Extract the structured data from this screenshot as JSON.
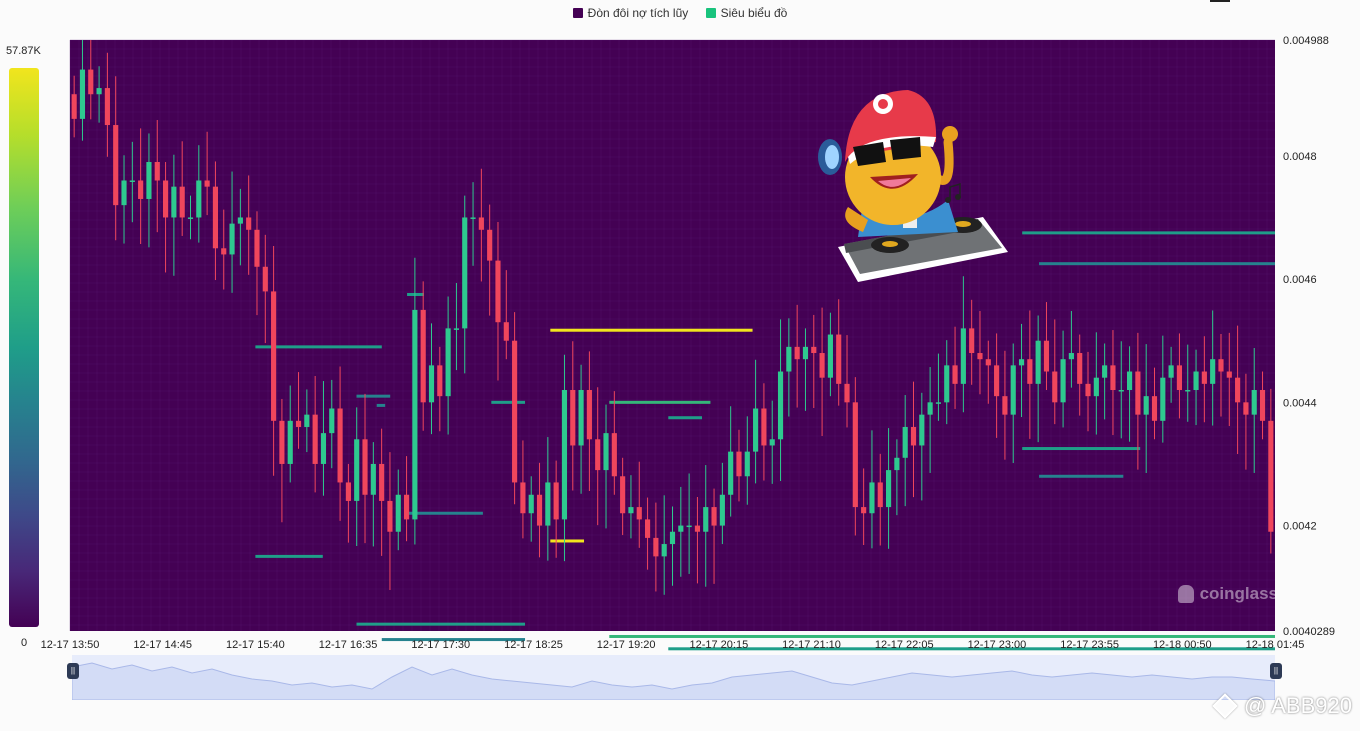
{
  "legend": {
    "items": [
      {
        "label": "Đòn đôi nợ tích lũy",
        "color": "#440154"
      },
      {
        "label": "Siêu biểu đồ",
        "color": "#19c37d"
      }
    ]
  },
  "colorbar": {
    "max_label": "57.87K",
    "min_label": "0"
  },
  "watermark": {
    "text": "coinglass"
  },
  "brand": {
    "text": "@ ABB920"
  },
  "chart_data": {
    "type": "candlestick",
    "background": "#440154",
    "up_color": "#2ec98f",
    "down_color": "#f0465c",
    "ylim": [
      0.0040289,
      0.004988
    ],
    "y_ticks": [
      "0.004988",
      "0.0048",
      "0.0046",
      "0.0044",
      "0.0042",
      "0.0040289"
    ],
    "x_ticks": [
      "12-17 13:50",
      "12-17 14:45",
      "12-17 15:40",
      "12-17 16:35",
      "12-17 17:30",
      "12-17 18:25",
      "12-17 19:20",
      "12-17 20:15",
      "12-17 21:10",
      "12-17 22:05",
      "12-17 23:00",
      "12-17 23:55",
      "12-18 00:50",
      "12-18 01:45"
    ],
    "candles_close": [
      0.00486,
      0.00494,
      0.0049,
      0.00491,
      0.00485,
      0.00472,
      0.00476,
      0.00476,
      0.00473,
      0.00479,
      0.00476,
      0.0047,
      0.00475,
      0.0047,
      0.0047,
      0.00476,
      0.00475,
      0.00465,
      0.00464,
      0.00469,
      0.0047,
      0.00468,
      0.00462,
      0.00458,
      0.00437,
      0.0043,
      0.00437,
      0.00436,
      0.00438,
      0.0043,
      0.00435,
      0.00439,
      0.00427,
      0.00424,
      0.00434,
      0.00425,
      0.0043,
      0.00424,
      0.00419,
      0.00425,
      0.00421,
      0.00455,
      0.0044,
      0.00446,
      0.00441,
      0.00452,
      0.00452,
      0.0047,
      0.0047,
      0.00468,
      0.00463,
      0.00453,
      0.0045,
      0.00427,
      0.00422,
      0.00425,
      0.0042,
      0.00427,
      0.00421,
      0.00442,
      0.00433,
      0.00442,
      0.00434,
      0.00429,
      0.00435,
      0.00428,
      0.00422,
      0.00423,
      0.00421,
      0.00418,
      0.00415,
      0.00417,
      0.00419,
      0.0042,
      0.0042,
      0.00419,
      0.00423,
      0.0042,
      0.00425,
      0.00432,
      0.00428,
      0.00432,
      0.00439,
      0.00433,
      0.00434,
      0.00445,
      0.00449,
      0.00447,
      0.00449,
      0.00448,
      0.00444,
      0.00451,
      0.00443,
      0.0044,
      0.00423,
      0.00422,
      0.00427,
      0.00423,
      0.00429,
      0.00431,
      0.00436,
      0.00433,
      0.00438,
      0.0044,
      0.0044,
      0.00446,
      0.00443,
      0.00452,
      0.00448,
      0.00447,
      0.00446,
      0.00441,
      0.00438,
      0.00446,
      0.00447,
      0.00443,
      0.0045,
      0.00445,
      0.0044,
      0.00447,
      0.00448,
      0.00443,
      0.00441,
      0.00444,
      0.00446,
      0.00442,
      0.00442,
      0.00445,
      0.00438,
      0.00441,
      0.00437,
      0.00444,
      0.00446,
      0.00442,
      0.00442,
      0.00445,
      0.00443,
      0.00447,
      0.00445,
      0.00444,
      0.0044,
      0.00438,
      0.00442,
      0.00437,
      0.00419
    ],
    "heatmap_lines": [
      {
        "price": 0.00449,
        "x_range": [
          "12-17 15:40",
          "12-17 16:55"
        ],
        "level": 0.55
      },
      {
        "price": 0.00415,
        "x_range": [
          "12-17 15:40",
          "12-17 16:20"
        ],
        "level": 0.52
      },
      {
        "price": 0.00441,
        "x_range": [
          "12-17 16:40",
          "12-17 17:00"
        ],
        "level": 0.45
      },
      {
        "price": 0.004395,
        "x_range": [
          "12-17 16:52",
          "12-17 16:57"
        ],
        "level": 0.45
      },
      {
        "price": 0.004575,
        "x_range": [
          "12-17 17:10",
          "12-17 17:20"
        ],
        "level": 0.5
      },
      {
        "price": 0.00422,
        "x_range": [
          "12-17 17:10",
          "12-17 17:55"
        ],
        "level": 0.45
      },
      {
        "price": 0.00404,
        "x_range": [
          "12-17 16:40",
          "12-17 18:20"
        ],
        "level": 0.55
      },
      {
        "price": 0.004015,
        "x_range": [
          "12-17 16:55",
          "12-17 18:20"
        ],
        "level": 0.42
      },
      {
        "price": 0.0044,
        "x_range": [
          "12-17 18:00",
          "12-17 18:20"
        ],
        "level": 0.5
      },
      {
        "price": 0.004517,
        "x_range": [
          "12-17 18:35",
          "12-17 20:35"
        ],
        "level": 1.0
      },
      {
        "price": 0.004175,
        "x_range": [
          "12-17 18:35",
          "12-17 18:55"
        ],
        "level": 0.98
      },
      {
        "price": 0.0044,
        "x_range": [
          "12-17 19:10",
          "12-17 20:10"
        ],
        "level": 0.72
      },
      {
        "price": 0.004375,
        "x_range": [
          "12-17 19:45",
          "12-17 20:05"
        ],
        "level": 0.5
      },
      {
        "price": 0.00402,
        "x_range": [
          "12-17 19:10",
          "12-18 01:45"
        ],
        "level": 0.62
      },
      {
        "price": 0.004,
        "x_range": [
          "12-17 19:45",
          "12-18 01:45"
        ],
        "level": 0.5
      },
      {
        "price": 0.004675,
        "x_range": [
          "12-17 23:15",
          "12-18 01:45"
        ],
        "level": 0.58
      },
      {
        "price": 0.004625,
        "x_range": [
          "12-17 23:25",
          "12-18 01:45"
        ],
        "level": 0.45
      },
      {
        "price": 0.004325,
        "x_range": [
          "12-17 23:15",
          "12-18 00:25"
        ],
        "level": 0.55
      },
      {
        "price": 0.00428,
        "x_range": [
          "12-17 23:25",
          "12-18 00:15"
        ],
        "level": 0.45
      }
    ]
  }
}
